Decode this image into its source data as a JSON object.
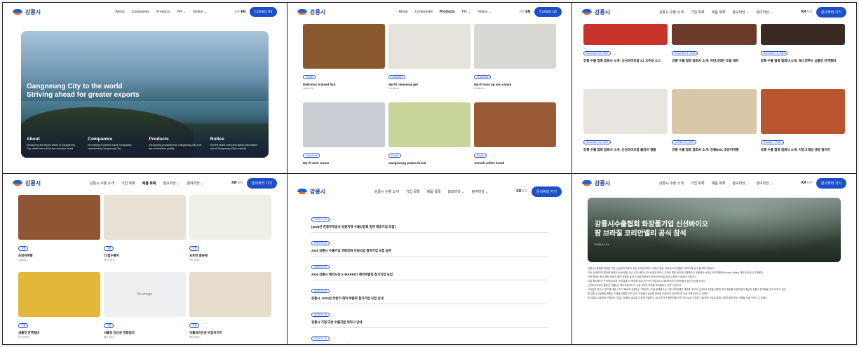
{
  "panel1": {
    "logo": "강릉시",
    "menu": [
      "About",
      "Companies",
      "Products",
      "PR ⌄",
      "Notice ⌄"
    ],
    "lang": {
      "kr": "KR",
      "en": "EN"
    },
    "cta": "Contact Us",
    "hero_title_1": "Gangneung City to the world",
    "hero_title_2": "Striving ahead for greater exports",
    "cols": [
      {
        "title": "About",
        "text": "Introducing the export vision of Gangneung City, which has a blue sea and pine forest"
      },
      {
        "title": "Companies",
        "text": "Introducing excellent export companies representing Gangneung City"
      },
      {
        "title": "Products",
        "text": "Introducing products from Gangneung City that are of excellent quality"
      },
      {
        "title": "Notice",
        "text": "Get the latest news and useful information about Gangneung City's exports"
      }
    ]
  },
  "panel2": {
    "logo": "강릉시",
    "menu": [
      "About",
      "Companies",
      "Products",
      "PR ⌄",
      "Notice ⌄"
    ],
    "lang": {
      "kr": "KR",
      "en": "EN"
    },
    "cta": "Contact Us",
    "products": [
      {
        "tag": "Foods",
        "title": "Delicious braised fish",
        "sub": "Jaban Inc",
        "bg": "#8a5a2e"
      },
      {
        "tag": "Cosmetics",
        "title": "My-fit cleansing gel",
        "sub": "Cenabom",
        "bg": "#e6e2dc"
      },
      {
        "tag": "Cosmetics",
        "title": "My-fit tone up sun cream",
        "sub": "Cenabom",
        "bg": "#d9d7d3"
      },
      {
        "tag": "Cosmetics",
        "title": "My-fit mist serum",
        "sub": "",
        "bg": "#c9cdd3"
      },
      {
        "tag": "Foods",
        "title": "Gangneung potato bread",
        "sub": "",
        "bg": "#c7d49a"
      },
      {
        "tag": "Foods",
        "title": "Anmok coffee bread",
        "sub": "",
        "bg": "#9a5a34"
      }
    ]
  },
  "panel3": {
    "logo": "강릉시",
    "menu": [
      "강릉시 수출 소개",
      "기업 목록",
      "제품 목록",
      "홍보마당 ⌄",
      "참여마당 ⌄"
    ],
    "lang": {
      "kr": "KR",
      "en": "EN"
    },
    "cta": "문의하러 가기",
    "news": [
      {
        "date": "December 29, 2025",
        "title": "강릉 수출 협회 협회사 소개: 신선바이오팜 X2 고추장 소스",
        "bg": "#c8342b",
        "tall": false
      },
      {
        "date": "December 4, 2025",
        "title": "강릉 수출 협회 협회사 소개: 자반고래단 조림 세트",
        "bg": "#6b3a2a",
        "tall": false
      },
      {
        "date": "November 15, 2025",
        "title": "강릉 수출 협회 협회사 소개: 에스앤푸드 심플잇 단백질바",
        "bg": "#3a2a24",
        "tall": false
      },
      {
        "date": "November 15, 2025",
        "title": "강릉 수출 협회 협회사 소개: 신선바이오팜 클리어 앰플",
        "bg": "#e8e4df",
        "tall": true
      },
      {
        "date": "October 25, 2025",
        "title": "강릉 수출 협회 협회사 소개: 강릉BNC 초당커피빵",
        "bg": "#d9c7a8",
        "tall": true
      },
      {
        "date": "October 7, 2025",
        "title": "강릉 수출 협회 협회사 소개: 자반고래방 냉동 밀키트",
        "bg": "#b8542e",
        "tall": true
      }
    ]
  },
  "panel4": {
    "logo": "강릉시",
    "menu": [
      "강릉시 수출 소개",
      "기업 목록",
      "제품 목록",
      "홍보마당 ⌄",
      "참여마당 ⌄"
    ],
    "lang": {
      "kr": "KR",
      "en": "EN"
    },
    "cta": "문의하러 가기",
    "products": [
      {
        "tag": "식품",
        "title": "초당커피빵",
        "sub": "강릉BNC",
        "bg": "#8e5634",
        "noimage": false
      },
      {
        "tag": "식품",
        "title": "더 컵누룽지",
        "sub": "에스앤푸드",
        "bg": "#e8e2d6",
        "noimage": false
      },
      {
        "tag": "식품",
        "title": "오트연 콩분에",
        "sub": "에스앤푸드",
        "bg": "#eef0e6",
        "noimage": false
      },
      {
        "tag": "식품",
        "title": "심플잇 단백질바",
        "sub": "에스앤푸드",
        "bg": "#e3b83a",
        "noimage": false
      },
      {
        "tag": "식품",
        "title": "식물성 유산균 쌍화엽리",
        "sub": "웰인피에스",
        "bg": "#eeeff1",
        "noimage": true
      },
      {
        "tag": "식품",
        "title": "식물성유산균 덕엄이키트",
        "sub": "웰인피에스",
        "bg": "#e6dccb",
        "noimage": false
      }
    ],
    "noimage_label": "No image"
  },
  "panel5": {
    "logo": "강릉시",
    "menu": [
      "강릉시 수출 소개",
      "기업 목록",
      "제품 목록",
      "홍보마당 ⌄",
      "참여마당 ⌄"
    ],
    "lang": {
      "kr": "KR",
      "en": "EN"
    },
    "cta": "문의하러 가기",
    "items": [
      {
        "date": "2025-09-10",
        "title": "[2025년 한중무역공사 강원지역 수출상담회 참여 제조기업 모집]"
      },
      {
        "date": "2025-09-10",
        "title": "2026 강릉시 수출기업 역량강화 지원사업 참여기업 모집 공부"
      },
      {
        "date": "2025-09-10",
        "title": "2026 강릉시 해외시장 K-MARKET 해외박람회 참가기업 모집"
      },
      {
        "date": "2025-09-10",
        "title": "강릉시, 2024년 하반기 해외 박람회 참가기업 모집 안내"
      },
      {
        "date": "2025-09-10",
        "title": "강릉시 기업 대상 수출지원 세미나 안내"
      },
      {
        "date": "2025-09-10",
        "title": "강릉시 신년회 및 네트워킹 행사 안내"
      }
    ]
  },
  "panel6": {
    "logo": "강릉시",
    "menu": [
      "강릉시 수출 소개",
      "기업 목록",
      "제품 목록",
      "홍보마당 ⌄",
      "참여마당 ⌄"
    ],
    "lang": {
      "kr": "KR",
      "en": "EN"
    },
    "cta": "문의하러 가기",
    "title_1": "강릉시수출협회 화장품기업 신선바이오",
    "title_2": "팜 브라질 코리안밸리 공식 참석",
    "date": "2025-12-01",
    "body": [
      "강릉시수출협회 화장품 기업 '신선바이오팜'이 최근 브라질 파라나 주에서 열린 '브라질 코리안밸리' 개막식에 공식 참석해 주목된다.",
      "지난 신선바이오팜강원 총괄이사(브라질) 지난 12일 (현지시간) 브라질 파라나 주에서 열린 공유정 단체협력식 대회에서 브라질 코리안밸리(Korean Valley) 개막식에 공식 초청됐다.",
      "이번 행사는 한국 문화 체험과 협력 방향을 알리기 위해 마련되는 한국의 브라질 파라나 협력이 대상인 사업이다.",
      "이날 행사에서 신선바이오팜은 '브라질행' 내 화장품 분야 첫 한국 기업으로 소개되며 한국 관계자들의 높은 관심을 받았다.",
      "신선바이오팜은 클렌징, 앰플 등, 에어오일바디크 기술 기반의 화장품 포트폴리오 운영 기업이다.",
      "브라질은 최근 K-뷰티에 대한 수요가 빠르게 성장하는 지역이다. 또한 현재에서는 이번 코리안밸리 계약을 계기로 신선바이오팜을 비롯한 한국 화장품 브랜드들의 중남미 진출이 본격화될 것으로 보고 있다.",
      "한 강릉시수출협회 회원은 기업을 비롯한 여러 국내 기업들이 글로벌 현장에 진출하며 성장하도록 지속 지원하겠다고 전했다.",
      "한 강릉시수출협회 관계자는 \"강릉 기업들이 글로벌 시장에 진출할 수 있도록 적극 협력하겠다\"며 '앞으로도 다양한 수출지원 사업을 통해 기업의 해외 판로 개척을 도울 것이다'고 밝혔다."
    ]
  }
}
